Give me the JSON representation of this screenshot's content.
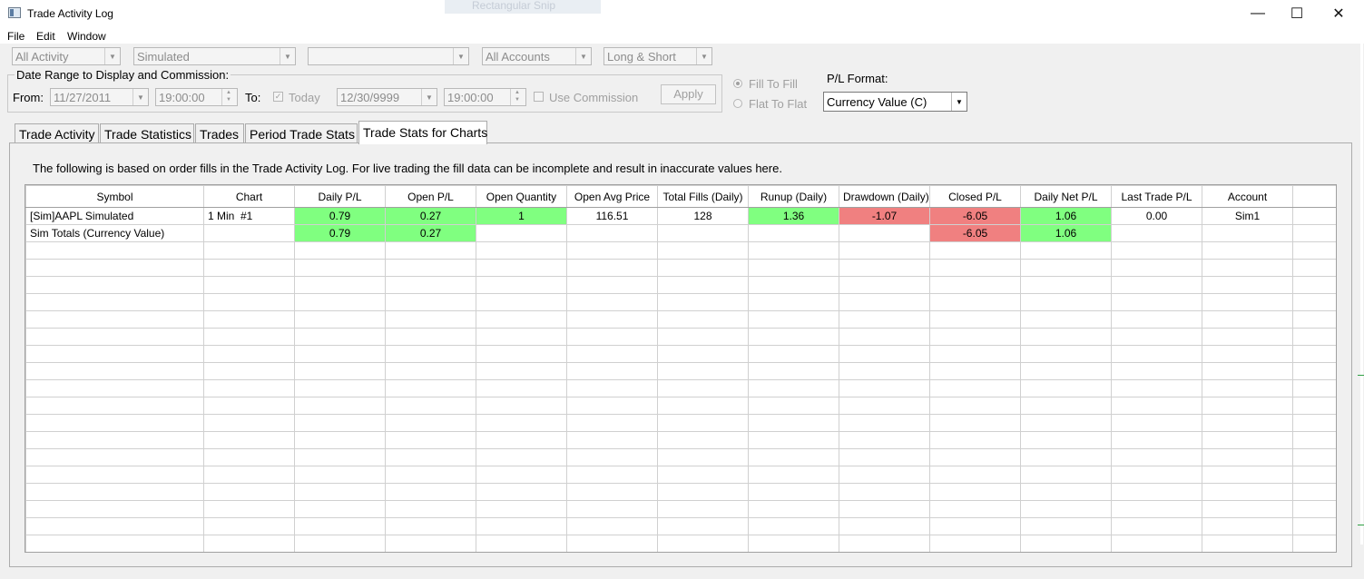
{
  "window": {
    "title": "Trade Activity Log",
    "ghost_text": "Rectangular Snip",
    "minimize_glyph": "—",
    "maximize_glyph": "☐",
    "close_glyph": "✕"
  },
  "menu": [
    "File",
    "Edit",
    "Window"
  ],
  "filters": {
    "activity": "All Activity",
    "mode": "Simulated",
    "blank": "",
    "accounts": "All Accounts",
    "side": "Long & Short"
  },
  "date_range": {
    "legend": "Date Range to Display and Commission:",
    "from_label": "From:",
    "from_date": "11/27/2011",
    "from_time": "19:00:00",
    "to_label": "To:",
    "today_label": "Today",
    "today_check": "✓",
    "to_date": "12/30/9999",
    "to_time": "19:00:00",
    "commission_label": "Use Commission",
    "apply_label": "Apply"
  },
  "fill_mode": {
    "fill_to_fill": "Fill To Fill",
    "flat_to_flat": "Flat To Flat"
  },
  "pl_format": {
    "label": "P/L Format:",
    "value": "Currency Value (C)"
  },
  "tabs": [
    "Trade Activity",
    "Trade Statistics",
    "Trades",
    "Period Trade Stats",
    "Trade Stats for Charts"
  ],
  "notice": "The following is based on order fills in the Trade Activity Log. For live trading the fill data can be incomplete and result in inaccurate values here.",
  "table": {
    "headers": [
      "Symbol",
      "Chart",
      "Daily P/L",
      "Open P/L",
      "Open Quantity",
      "Open Avg Price",
      "Total Fills (Daily)",
      "Runup (Daily)",
      "Drawdown (Daily)",
      "Closed P/L",
      "Daily Net P/L",
      "Last Trade P/L",
      "Account",
      ""
    ],
    "rows": [
      [
        "[Sim]AAPL Simulated",
        "1 Min  #1",
        "0.79",
        "0.27",
        "1",
        "116.51",
        "128",
        "1.36",
        "-1.07",
        "-6.05",
        "1.06",
        "0.00",
        "Sim1",
        ""
      ],
      [
        "Sim Totals (Currency Value)",
        "",
        "0.79",
        "0.27",
        "",
        "",
        "",
        "",
        "",
        "-6.05",
        "1.06",
        "",
        "",
        ""
      ]
    ],
    "cell_state": [
      [
        "",
        "",
        "pos",
        "pos",
        "pos",
        "",
        "",
        "pos",
        "neg",
        "neg",
        "pos",
        "",
        "",
        ""
      ],
      [
        "",
        "",
        "pos",
        "pos",
        "",
        "",
        "",
        "",
        "",
        "neg",
        "pos",
        "",
        "",
        ""
      ]
    ],
    "empty_rows": 18
  },
  "colors": {
    "positive": "#80ff80",
    "negative": "#f08080"
  },
  "icons": {
    "dropdown": "chevron-down-icon",
    "spin": "spin-arrows-icon",
    "app": "app-window-icon"
  }
}
